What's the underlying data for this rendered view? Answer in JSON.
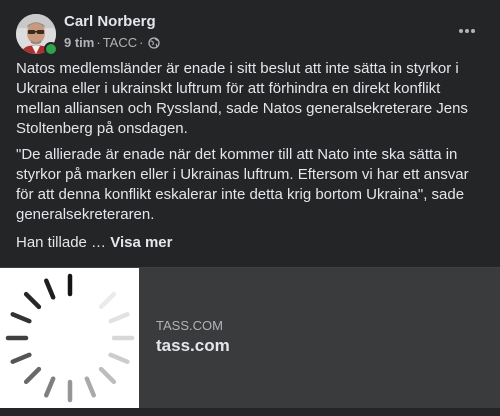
{
  "post": {
    "author": "Carl Norberg",
    "time": "9 tim",
    "source": "TACC",
    "separator": "·",
    "privacy_icon": "globe-icon",
    "more_icon": "more-horizontal-icon",
    "paragraphs": [
      "Natos medlemsländer är enade i sitt beslut att inte sätta in styrkor i Ukraina eller i ukrainskt luftrum för att förhindra en direkt konflikt mellan alliansen och Ryssland, sade Natos generalsekreterare Jens Stoltenberg på onsdagen.",
      "\"De allierade är enade när det kommer till att Nato inte ska sätta in styrkor på marken eller i Ukrainas luftrum. Eftersom vi har ett ansvar för att denna konflikt eskalerar inte detta krig bortom Ukraina\", sade generalsekreteraren."
    ],
    "truncated_text": "Han tillade … ",
    "see_more_label": "Visa mer"
  },
  "link_preview": {
    "domain": "TASS.COM",
    "title": "tass.com",
    "thumbnail_icon": "loading-spinner-icon"
  },
  "colors": {
    "background": "#242526",
    "text_primary": "#e4e6eb",
    "text_secondary": "#b0b3b8",
    "preview_bg": "#3a3b3c",
    "online": "#31a24c"
  }
}
